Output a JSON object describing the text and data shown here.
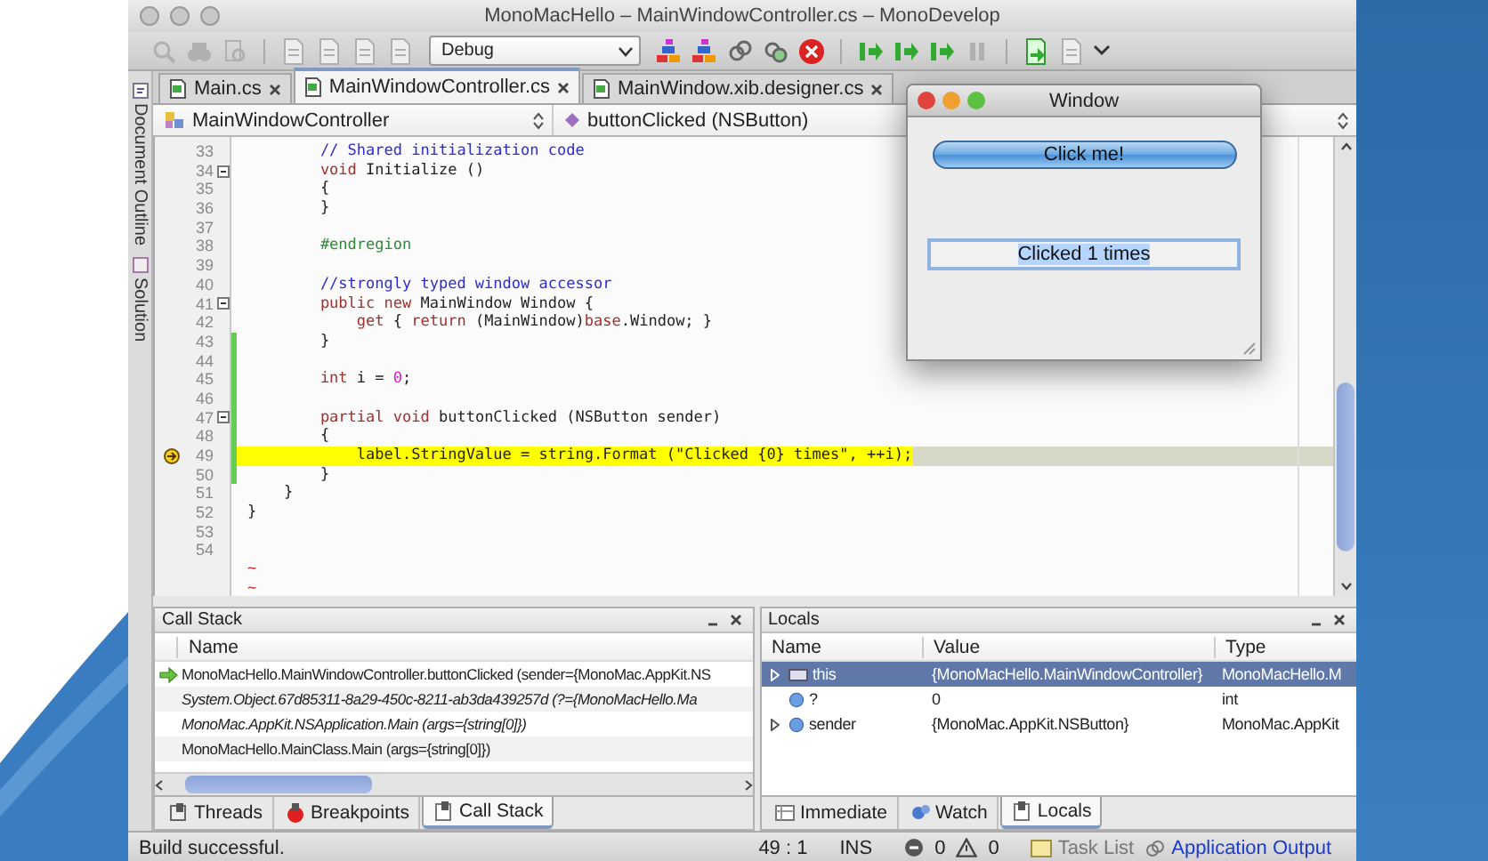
{
  "window": {
    "title": "MonoMacHello – MainWindowController.cs – MonoDevelop"
  },
  "toolbar": {
    "configuration": "Debug"
  },
  "side_tabs": [
    {
      "label": "Document Outline"
    },
    {
      "label": "Solution"
    }
  ],
  "document_tabs": [
    {
      "label": "Main.cs",
      "selected": false
    },
    {
      "label": "MainWindowController.cs",
      "selected": true
    },
    {
      "label": "MainWindow.xib.designer.cs",
      "selected": false
    }
  ],
  "navigation": {
    "class": "MainWindowController",
    "member": "buttonClicked (NSButton)"
  },
  "editor": {
    "lines": [
      {
        "number": "33",
        "fold": false,
        "changed": false,
        "current": false,
        "tokens": [
          {
            "kind": "comment",
            "text": "        // Shared initialization code"
          }
        ]
      },
      {
        "number": "34",
        "fold": true,
        "changed": false,
        "current": false,
        "tokens": [
          {
            "kind": "keyword",
            "text": "        void"
          },
          {
            "kind": "plain",
            "text": " Initialize ()"
          }
        ]
      },
      {
        "number": "35",
        "fold": false,
        "changed": false,
        "current": false,
        "tokens": [
          {
            "kind": "plain",
            "text": "        {"
          }
        ]
      },
      {
        "number": "36",
        "fold": false,
        "changed": false,
        "current": false,
        "tokens": [
          {
            "kind": "plain",
            "text": "        }"
          }
        ]
      },
      {
        "number": "37",
        "fold": false,
        "changed": false,
        "current": false
      },
      {
        "number": "38",
        "fold": false,
        "changed": false,
        "current": false,
        "tokens": [
          {
            "kind": "preprocessor",
            "text": "        #endregion"
          }
        ]
      },
      {
        "number": "39",
        "fold": false,
        "changed": false,
        "current": false
      },
      {
        "number": "40",
        "fold": false,
        "changed": false,
        "current": false,
        "tokens": [
          {
            "kind": "comment",
            "text": "        //strongly typed window accessor"
          }
        ]
      },
      {
        "number": "41",
        "fold": true,
        "changed": false,
        "current": false,
        "tokens": [
          {
            "kind": "keyword",
            "text": "        public new"
          },
          {
            "kind": "plain",
            "text": " MainWindow Window {"
          }
        ]
      },
      {
        "number": "42",
        "fold": false,
        "changed": false,
        "current": false,
        "tokens": [
          {
            "kind": "keyword",
            "text": "            get"
          },
          {
            "kind": "plain",
            "text": " { "
          },
          {
            "kind": "keyword",
            "text": "return"
          },
          {
            "kind": "plain",
            "text": " (MainWindow)"
          },
          {
            "kind": "keyword",
            "text": "base"
          },
          {
            "kind": "plain",
            "text": ".Window; }"
          }
        ]
      },
      {
        "number": "43",
        "fold": false,
        "changed": true,
        "current": false,
        "tokens": [
          {
            "kind": "plain",
            "text": "        }"
          }
        ]
      },
      {
        "number": "44",
        "fold": false,
        "changed": true,
        "current": false
      },
      {
        "number": "45",
        "fold": false,
        "changed": true,
        "current": false,
        "tokens": [
          {
            "kind": "keyword",
            "text": "        int"
          },
          {
            "kind": "plain",
            "text": " i = "
          },
          {
            "kind": "number",
            "text": "0"
          },
          {
            "kind": "plain",
            "text": ";"
          }
        ]
      },
      {
        "number": "46",
        "fold": false,
        "changed": true,
        "current": false
      },
      {
        "number": "47",
        "fold": true,
        "changed": true,
        "current": false,
        "tokens": [
          {
            "kind": "keyword",
            "text": "        partial void"
          },
          {
            "kind": "plain",
            "text": " buttonClicked (NSButton sender)"
          }
        ]
      },
      {
        "number": "48",
        "fold": false,
        "changed": true,
        "current": false,
        "tokens": [
          {
            "kind": "plain",
            "text": "        {"
          }
        ]
      },
      {
        "number": "49",
        "fold": false,
        "changed": true,
        "current": true,
        "tokens": [
          {
            "kind": "plain",
            "text": "            label.StringValue = string.Format (\"Clicked {0} times\", ++i);"
          }
        ]
      },
      {
        "number": "50",
        "fold": false,
        "changed": true,
        "current": false,
        "tokens": [
          {
            "kind": "plain",
            "text": "        }"
          }
        ]
      },
      {
        "number": "51",
        "fold": false,
        "changed": false,
        "current": false,
        "tokens": [
          {
            "kind": "plain",
            "text": "    }"
          }
        ]
      },
      {
        "number": "52",
        "fold": false,
        "changed": false,
        "current": false,
        "tokens": [
          {
            "kind": "plain",
            "text": "}"
          }
        ]
      },
      {
        "number": "53",
        "fold": false,
        "changed": false,
        "current": false
      },
      {
        "number": "54",
        "fold": false,
        "changed": false,
        "current": false
      }
    ],
    "empty_line_markers": [
      "~",
      "~"
    ]
  },
  "app_window": {
    "title": "Window",
    "button": "Click me!",
    "label": "Clicked 1 times",
    "text_selected": true
  },
  "call_stack": {
    "title": "Call Stack",
    "columns": [
      "Name"
    ],
    "rows": [
      {
        "text": "MonoMacHello.MainWindowController.buttonClicked (sender={MonoMac.AppKit.NS",
        "current": true,
        "external": false
      },
      {
        "text": "System.Object.67d85311-8a29-450c-8211-ab3da439257d (?={MonoMacHello.Ma",
        "current": false,
        "external": true
      },
      {
        "text": "MonoMac.AppKit.NSApplication.Main (args={string[0]})",
        "current": false,
        "external": true
      },
      {
        "text": "MonoMacHello.MainClass.Main (args={string[0]})",
        "current": false,
        "external": false
      }
    ]
  },
  "locals": {
    "title": "Locals",
    "columns": [
      "Name",
      "Value",
      "Type"
    ],
    "rows": [
      {
        "kind": "object",
        "name": "this",
        "value": "{MonoMacHello.MainWindowController}",
        "type": "MonoMacHello.M",
        "expandable": true,
        "selected": true
      },
      {
        "kind": "variable",
        "name": "?",
        "value": "0",
        "type": "int",
        "expandable": false,
        "selected": false
      },
      {
        "kind": "variable",
        "name": "sender",
        "value": "{MonoMac.AppKit.NSButton}",
        "type": "MonoMac.AppKit",
        "expandable": true,
        "selected": false
      }
    ]
  },
  "left_pad_tabs": [
    {
      "label": "Threads",
      "selected": false
    },
    {
      "label": "Breakpoints",
      "selected": false
    },
    {
      "label": "Call Stack",
      "selected": true
    }
  ],
  "right_pad_tabs": [
    {
      "label": "Immediate",
      "selected": false
    },
    {
      "label": "Watch",
      "selected": false
    },
    {
      "label": "Locals",
      "selected": true
    }
  ],
  "status_bar": {
    "message": "Build successful.",
    "position": "49 : 1",
    "mode": "INS",
    "errors": "0",
    "warnings": "0",
    "task_list": "Task List",
    "application_output": "Application Output"
  }
}
